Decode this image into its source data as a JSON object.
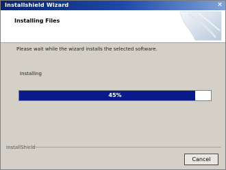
{
  "window": {
    "title": "Installshield Wizard",
    "close_glyph": "×"
  },
  "header": {
    "heading": "Installing Files",
    "art_icon": "cd-disc-icon"
  },
  "body": {
    "description": "Please wait while the wizard installs the selected software.",
    "status_label": "Installing"
  },
  "progress": {
    "percent_label": "45%",
    "fraction": 0.45
  },
  "footer": {
    "brand_text": "InstallShield"
  },
  "buttons": {
    "cancel_label": "Cancel"
  },
  "colors": {
    "title_start": "#0a246a",
    "progress_fill": "#0a1a8a",
    "dialog_face": "#d4d0c8"
  }
}
